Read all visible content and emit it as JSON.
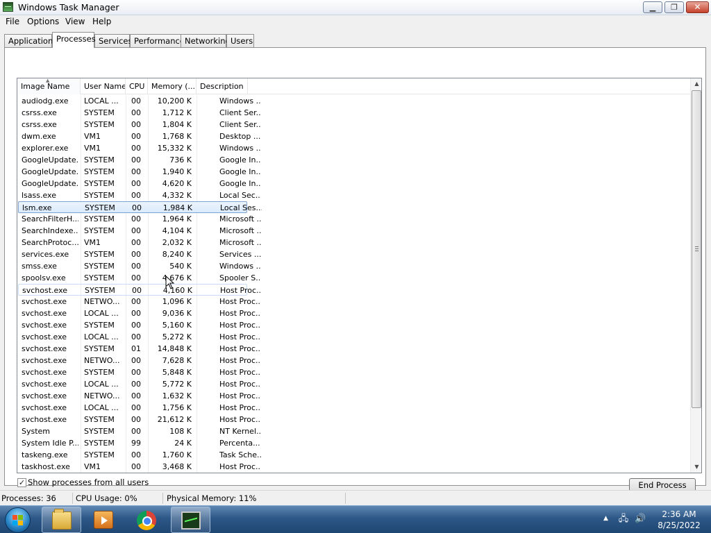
{
  "window": {
    "title": "Windows Task Manager",
    "controls": {
      "minimize": "▁",
      "maximize": "❐",
      "close": "✕"
    }
  },
  "menu": [
    "File",
    "Options",
    "View",
    "Help"
  ],
  "tabs": [
    "Applications",
    "Processes",
    "Services",
    "Performance",
    "Networking",
    "Users"
  ],
  "active_tab": "Processes",
  "columns": [
    "Image Name",
    "User Name",
    "CPU",
    "Memory (...",
    "Description"
  ],
  "sort_column": "Image Name",
  "processes": [
    {
      "name": "audiodg.exe",
      "user": "LOCAL ...",
      "cpu": "00",
      "mem": "10,200 K",
      "desc": "Windows ..."
    },
    {
      "name": "csrss.exe",
      "user": "SYSTEM",
      "cpu": "00",
      "mem": "1,712 K",
      "desc": "Client Ser..."
    },
    {
      "name": "csrss.exe",
      "user": "SYSTEM",
      "cpu": "00",
      "mem": "1,804 K",
      "desc": "Client Ser..."
    },
    {
      "name": "dwm.exe",
      "user": "VM1",
      "cpu": "00",
      "mem": "1,768 K",
      "desc": "Desktop ..."
    },
    {
      "name": "explorer.exe",
      "user": "VM1",
      "cpu": "00",
      "mem": "15,332 K",
      "desc": "Windows ..."
    },
    {
      "name": "GoogleUpdate...",
      "user": "SYSTEM",
      "cpu": "00",
      "mem": "736 K",
      "desc": "Google In..."
    },
    {
      "name": "GoogleUpdate...",
      "user": "SYSTEM",
      "cpu": "00",
      "mem": "1,940 K",
      "desc": "Google In..."
    },
    {
      "name": "GoogleUpdate...",
      "user": "SYSTEM",
      "cpu": "00",
      "mem": "4,620 K",
      "desc": "Google In..."
    },
    {
      "name": "lsass.exe",
      "user": "SYSTEM",
      "cpu": "00",
      "mem": "4,332 K",
      "desc": "Local Sec..."
    },
    {
      "name": "lsm.exe",
      "user": "SYSTEM",
      "cpu": "00",
      "mem": "1,984 K",
      "desc": "Local Ses..."
    },
    {
      "name": "SearchFilterH...",
      "user": "SYSTEM",
      "cpu": "00",
      "mem": "1,964 K",
      "desc": "Microsoft ..."
    },
    {
      "name": "SearchIndexe...",
      "user": "SYSTEM",
      "cpu": "00",
      "mem": "4,104 K",
      "desc": "Microsoft ..."
    },
    {
      "name": "SearchProtoc...",
      "user": "VM1",
      "cpu": "00",
      "mem": "2,032 K",
      "desc": "Microsoft ..."
    },
    {
      "name": "services.exe",
      "user": "SYSTEM",
      "cpu": "00",
      "mem": "8,240 K",
      "desc": "Services ..."
    },
    {
      "name": "smss.exe",
      "user": "SYSTEM",
      "cpu": "00",
      "mem": "540 K",
      "desc": "Windows ..."
    },
    {
      "name": "spoolsv.exe",
      "user": "SYSTEM",
      "cpu": "00",
      "mem": "4,676 K",
      "desc": "Spooler S..."
    },
    {
      "name": "svchost.exe",
      "user": "SYSTEM",
      "cpu": "00",
      "mem": "4,160 K",
      "desc": "Host Proc..."
    },
    {
      "name": "svchost.exe",
      "user": "NETWO...",
      "cpu": "00",
      "mem": "1,096 K",
      "desc": "Host Proc..."
    },
    {
      "name": "svchost.exe",
      "user": "LOCAL ...",
      "cpu": "00",
      "mem": "9,036 K",
      "desc": "Host Proc..."
    },
    {
      "name": "svchost.exe",
      "user": "SYSTEM",
      "cpu": "00",
      "mem": "5,160 K",
      "desc": "Host Proc..."
    },
    {
      "name": "svchost.exe",
      "user": "LOCAL ...",
      "cpu": "00",
      "mem": "5,272 K",
      "desc": "Host Proc..."
    },
    {
      "name": "svchost.exe",
      "user": "SYSTEM",
      "cpu": "01",
      "mem": "14,848 K",
      "desc": "Host Proc..."
    },
    {
      "name": "svchost.exe",
      "user": "NETWO...",
      "cpu": "00",
      "mem": "7,628 K",
      "desc": "Host Proc..."
    },
    {
      "name": "svchost.exe",
      "user": "SYSTEM",
      "cpu": "00",
      "mem": "5,848 K",
      "desc": "Host Proc..."
    },
    {
      "name": "svchost.exe",
      "user": "LOCAL ...",
      "cpu": "00",
      "mem": "5,772 K",
      "desc": "Host Proc..."
    },
    {
      "name": "svchost.exe",
      "user": "NETWO...",
      "cpu": "00",
      "mem": "1,632 K",
      "desc": "Host Proc..."
    },
    {
      "name": "svchost.exe",
      "user": "LOCAL ...",
      "cpu": "00",
      "mem": "1,756 K",
      "desc": "Host Proc..."
    },
    {
      "name": "svchost.exe",
      "user": "SYSTEM",
      "cpu": "00",
      "mem": "21,612 K",
      "desc": "Host Proc..."
    },
    {
      "name": "System",
      "user": "SYSTEM",
      "cpu": "00",
      "mem": "108 K",
      "desc": "NT Kernel..."
    },
    {
      "name": "System Idle P...",
      "user": "SYSTEM",
      "cpu": "99",
      "mem": "24 K",
      "desc": "Percenta..."
    },
    {
      "name": "taskeng.exe",
      "user": "SYSTEM",
      "cpu": "00",
      "mem": "1,760 K",
      "desc": "Task Sche..."
    },
    {
      "name": "taskhost.exe",
      "user": "VM1",
      "cpu": "00",
      "mem": "3,468 K",
      "desc": "Host Proc..."
    }
  ],
  "selected_process": "lsm.exe",
  "show_all_users": {
    "label": "Show processes from all users",
    "checked": true,
    "mark": "✓"
  },
  "end_process_label": "End Process",
  "status": {
    "processes": "Processes: 36",
    "cpu": "CPU Usage: 0%",
    "memory": "Physical Memory: 11%"
  },
  "taskbar": {
    "apps": [
      "folder-icon",
      "media-player-icon",
      "chrome-icon",
      "task-manager-icon"
    ],
    "tray_arrow": "▲",
    "tray_icons": {
      "network": "🖧",
      "volume": "🔊"
    },
    "time": "2:36 AM",
    "date": "8/25/2022"
  },
  "colors": {
    "selection_border": "#7da2ce",
    "taskbar": "#2d5786",
    "close_button": "#c4412b"
  }
}
